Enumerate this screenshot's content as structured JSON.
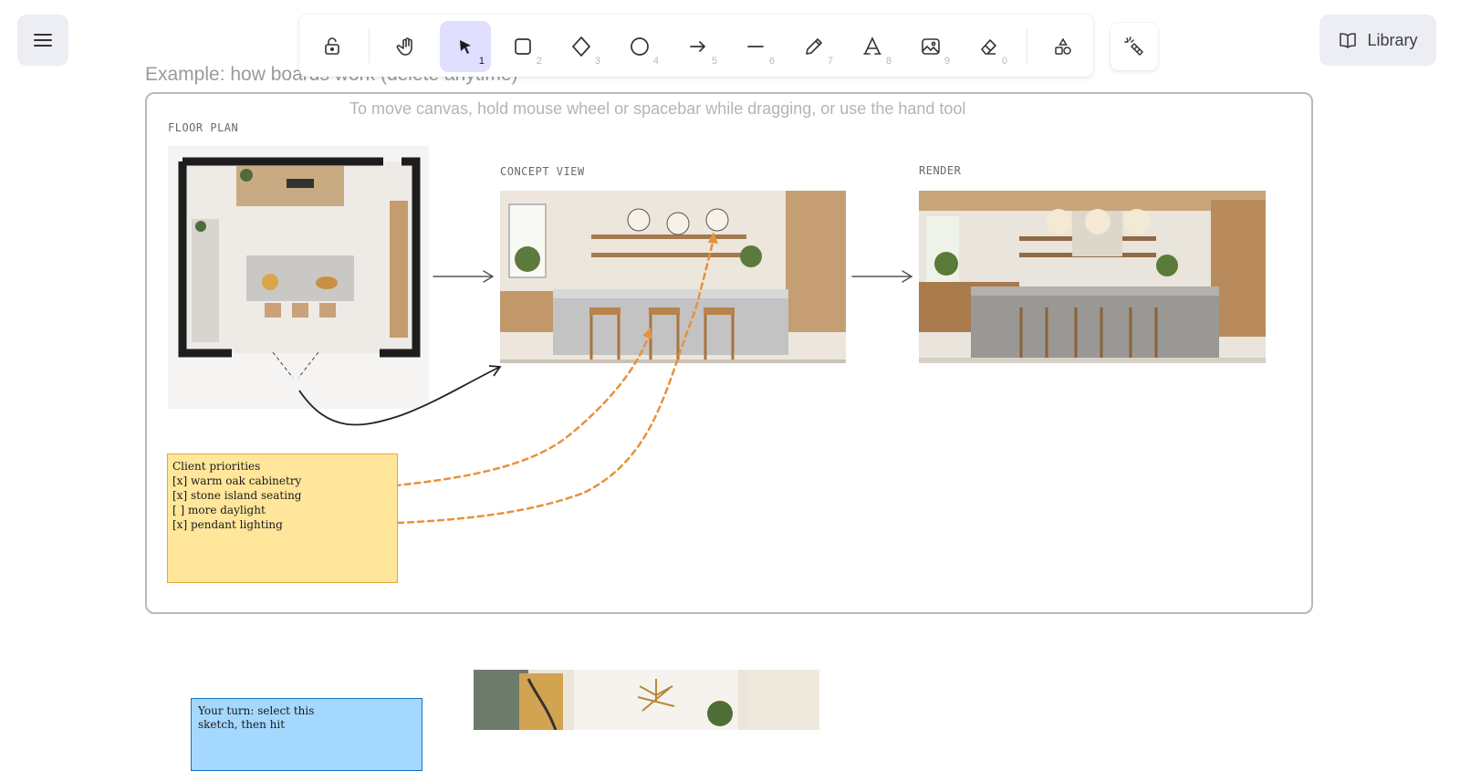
{
  "toolbar": {
    "tools": [
      {
        "name": "lock",
        "icon": "lock-open-icon",
        "key": ""
      },
      {
        "name": "hand",
        "icon": "hand-icon",
        "key": ""
      },
      {
        "name": "selection",
        "icon": "pointer-icon",
        "key": "1",
        "active": true
      },
      {
        "name": "rectangle",
        "icon": "rectangle-icon",
        "key": "2"
      },
      {
        "name": "diamond",
        "icon": "diamond-icon",
        "key": "3"
      },
      {
        "name": "ellipse",
        "icon": "ellipse-icon",
        "key": "4"
      },
      {
        "name": "arrow",
        "icon": "arrow-icon",
        "key": "5"
      },
      {
        "name": "line",
        "icon": "line-icon",
        "key": "6"
      },
      {
        "name": "draw",
        "icon": "pencil-icon",
        "key": "7"
      },
      {
        "name": "text",
        "icon": "text-icon",
        "key": "8"
      },
      {
        "name": "image",
        "icon": "image-icon",
        "key": "9"
      },
      {
        "name": "eraser",
        "icon": "eraser-icon",
        "key": "0"
      },
      {
        "name": "more-shapes",
        "icon": "shapes-icon",
        "key": ""
      }
    ],
    "active_color": "#e0dfff"
  },
  "library": {
    "label": "Library"
  },
  "canvas": {
    "board_title": "Example: how boards work (delete anytime)",
    "hint": "To move canvas, hold mouse wheel or spacebar while dragging, or use the hand tool",
    "labels": {
      "floor_plan": "FLOOR PLAN",
      "concept_view": "CONCEPT VIEW",
      "render": "RENDER"
    },
    "note": {
      "title": "Client priorities",
      "items": [
        "[x] warm oak cabinetry",
        "[x] stone island seating",
        "[ ] more daylight",
        "[x] pendant lighting"
      ],
      "color": "#ffe69b"
    },
    "note2": {
      "lines": [
        "Your turn: select this",
        "sketch, then hit"
      ],
      "color": "#a5d8ff"
    },
    "arrow_color": "#e8913a"
  }
}
